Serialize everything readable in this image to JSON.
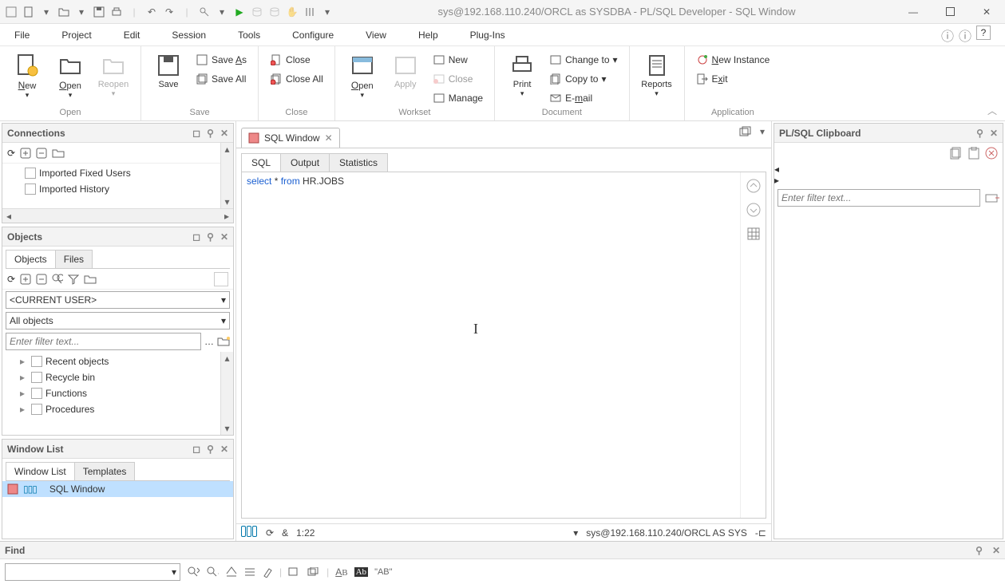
{
  "title": "sys@192.168.110.240/ORCL as SYSDBA - PL/SQL Developer - SQL Window",
  "menus": {
    "file": "File",
    "edit": "Edit",
    "project": "Project",
    "session": "Session",
    "tools": "Tools",
    "configure": "Configure",
    "view": "View",
    "help": "Help",
    "plugins": "Plug-Ins"
  },
  "ribbon": {
    "open": {
      "new": "New",
      "open": "Open",
      "reopen": "Reopen",
      "group": "Open"
    },
    "save": {
      "save": "Save",
      "saveas": "Save As",
      "saveall": "Save All",
      "group": "Save"
    },
    "close": {
      "close": "Close",
      "closeall": "Close All",
      "group": "Close"
    },
    "workset": {
      "open": "Open",
      "apply": "Apply",
      "new": "New",
      "close": "Close",
      "manage": "Manage",
      "group": "Workset"
    },
    "document": {
      "print": "Print",
      "changeto": "Change to",
      "copyto": "Copy to",
      "email": "E-mail",
      "group": "Document"
    },
    "reports": {
      "label": "Reports"
    },
    "app": {
      "newinstance": "New Instance",
      "exit": "Exit",
      "group": "Application"
    }
  },
  "connections": {
    "title": "Connections",
    "items": [
      "Imported Fixed Users",
      "Imported History"
    ]
  },
  "objects": {
    "title": "Objects",
    "tabs": {
      "objects": "Objects",
      "files": "Files"
    },
    "scope": "<CURRENT USER>",
    "cat": "All objects",
    "filter_ph": "Enter filter text...",
    "tree": [
      "Recent objects",
      "Recycle bin",
      "Functions",
      "Procedures"
    ]
  },
  "windowlist": {
    "title": "Window List",
    "tabs": {
      "wl": "Window List",
      "tpl": "Templates"
    },
    "item": "SQL Window"
  },
  "sql": {
    "doctab": "SQL Window",
    "tabs": {
      "sql": "SQL",
      "output": "Output",
      "stats": "Statistics"
    },
    "kw_select": "select",
    "star": " * ",
    "kw_from": "from",
    "rest": " HR.JOBS"
  },
  "status": {
    "time": "1:22",
    "conn": "sys@192.168.110.240/ORCL AS SYS"
  },
  "clipboard": {
    "title": "PL/SQL Clipboard",
    "filter_ph": "Enter filter text..."
  },
  "find": {
    "title": "Find",
    "sample": "\"AB\""
  }
}
